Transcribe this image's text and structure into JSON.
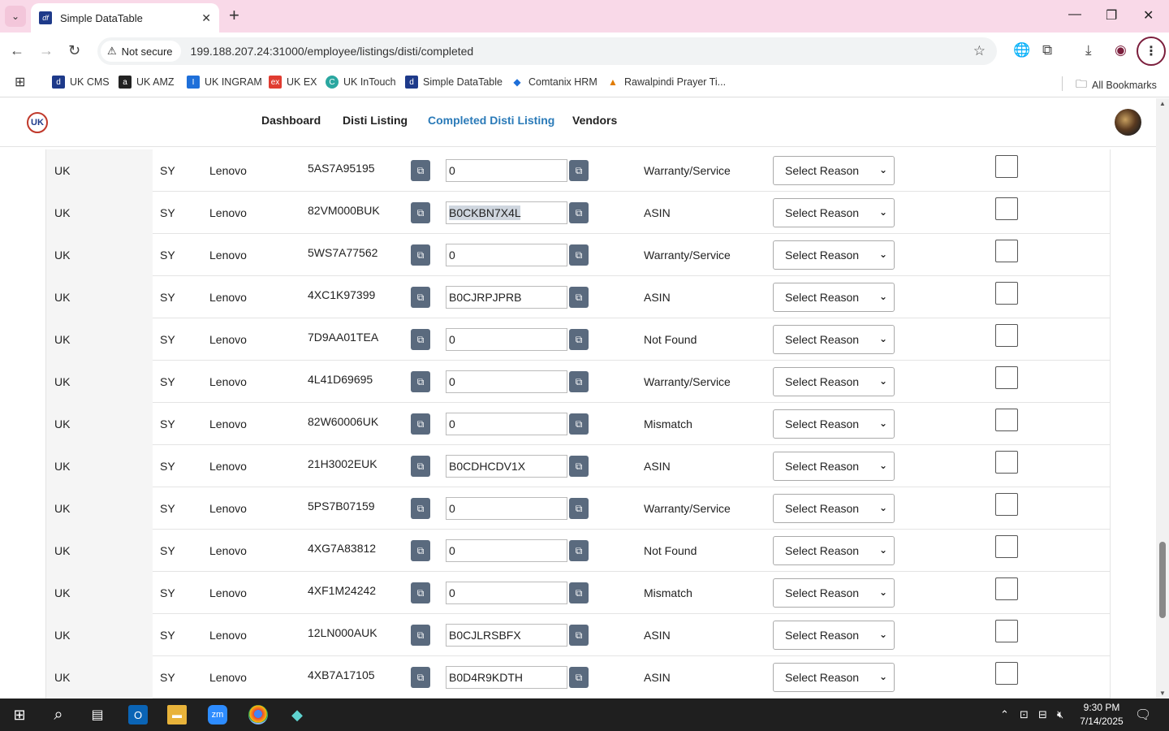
{
  "browser": {
    "tab_title": "Simple DataTable",
    "security_label": "Not secure",
    "url": "199.188.207.24:31000/employee/listings/disti/completed",
    "bookmarks": [
      {
        "label": "UK CMS",
        "color": "#1e3a8a",
        "glyph": "d"
      },
      {
        "label": "UK AMZ",
        "color": "#222222",
        "glyph": "a"
      },
      {
        "label": "UK INGRAM",
        "color": "#1e6fd9",
        "glyph": "I"
      },
      {
        "label": "UK EX",
        "color": "#e03c31",
        "glyph": "ex"
      },
      {
        "label": "UK InTouch",
        "color": "#2aa7a0",
        "glyph": "C"
      },
      {
        "label": "Simple DataTable",
        "color": "#1e3a8a",
        "glyph": "d"
      },
      {
        "label": "Comtanix HRM",
        "color": "#1e6fd9",
        "glyph": "◆"
      },
      {
        "label": "Rawalpindi Prayer Ti...",
        "color": "#e07b00",
        "glyph": "▲"
      }
    ],
    "all_bookmarks": "All Bookmarks"
  },
  "nav": {
    "items": [
      "Dashboard",
      "Disti Listing",
      "Completed Disti Listing",
      "Vendors"
    ],
    "active": "Completed Disti Listing",
    "logo_text": "UK"
  },
  "reason_placeholder": "Select Reason",
  "rows": [
    {
      "country": "UK",
      "supplier": "SY",
      "brand": "Lenovo",
      "part": "5AS7A95195",
      "asin": "0",
      "status": "Warranty/Service"
    },
    {
      "country": "UK",
      "supplier": "SY",
      "brand": "Lenovo",
      "part": "82VM000BUK",
      "asin": "B0CKBN7X4L",
      "status": "ASIN",
      "selected": true
    },
    {
      "country": "UK",
      "supplier": "SY",
      "brand": "Lenovo",
      "part": "5WS7A77562",
      "asin": "0",
      "status": "Warranty/Service"
    },
    {
      "country": "UK",
      "supplier": "SY",
      "brand": "Lenovo",
      "part": "4XC1K97399",
      "asin": "B0CJRPJPRB",
      "status": "ASIN"
    },
    {
      "country": "UK",
      "supplier": "SY",
      "brand": "Lenovo",
      "part": "7D9AA01TEA",
      "asin": "0",
      "status": "Not Found"
    },
    {
      "country": "UK",
      "supplier": "SY",
      "brand": "Lenovo",
      "part": "4L41D69695",
      "asin": "0",
      "status": "Warranty/Service"
    },
    {
      "country": "UK",
      "supplier": "SY",
      "brand": "Lenovo",
      "part": "82W60006UK",
      "asin": "0",
      "status": "Mismatch"
    },
    {
      "country": "UK",
      "supplier": "SY",
      "brand": "Lenovo",
      "part": "21H3002EUK",
      "asin": "B0CDHCDV1X",
      "status": "ASIN"
    },
    {
      "country": "UK",
      "supplier": "SY",
      "brand": "Lenovo",
      "part": "5PS7B07159",
      "asin": "0",
      "status": "Warranty/Service"
    },
    {
      "country": "UK",
      "supplier": "SY",
      "brand": "Lenovo",
      "part": "4XG7A83812",
      "asin": "0",
      "status": "Not Found"
    },
    {
      "country": "UK",
      "supplier": "SY",
      "brand": "Lenovo",
      "part": "4XF1M24242",
      "asin": "0",
      "status": "Mismatch"
    },
    {
      "country": "UK",
      "supplier": "SY",
      "brand": "Lenovo",
      "part": "12LN000AUK",
      "asin": "B0CJLRSBFX",
      "status": "ASIN"
    },
    {
      "country": "UK",
      "supplier": "SY",
      "brand": "Lenovo",
      "part": "4XB7A17105",
      "asin": "B0D4R9KDTH",
      "status": "ASIN"
    }
  ],
  "taskbar": {
    "time": "9:30 PM",
    "date": "7/14/2025"
  },
  "colors": {
    "accent": "#2a7ab8",
    "copy_button": "#5a6a7e",
    "tabstrip": "#f9d9e8"
  }
}
